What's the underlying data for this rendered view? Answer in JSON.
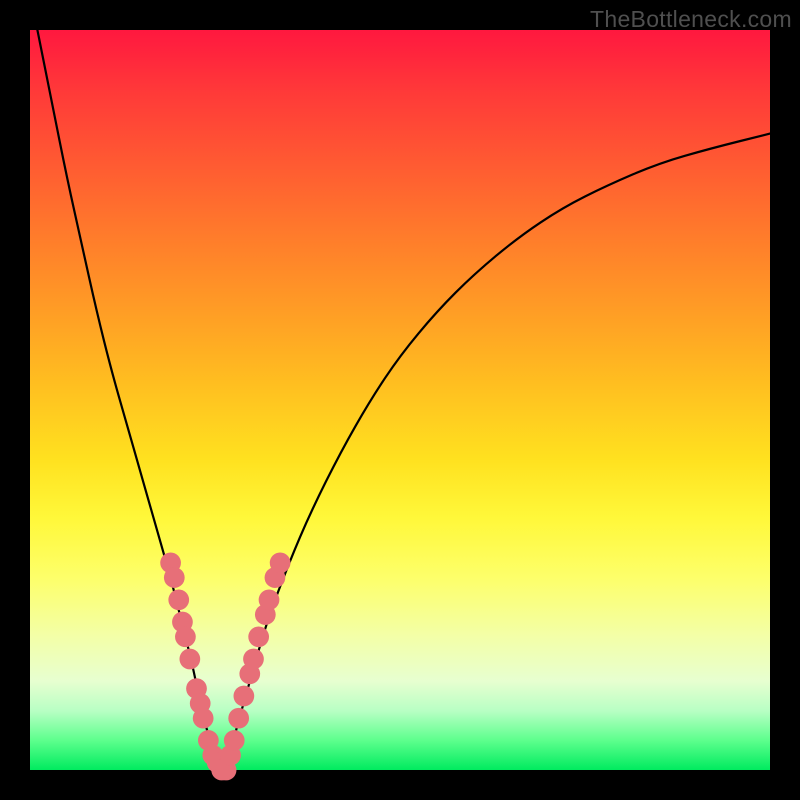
{
  "watermark": "TheBottleneck.com",
  "chart_data": {
    "type": "line",
    "title": "",
    "xlabel": "",
    "ylabel": "",
    "xlim": [
      0,
      100
    ],
    "ylim": [
      0,
      100
    ],
    "grid": false,
    "legend": false,
    "annotations": [],
    "gradient_stops": [
      {
        "pos": 0,
        "color": "#ff183f"
      },
      {
        "pos": 8,
        "color": "#ff3839"
      },
      {
        "pos": 18,
        "color": "#ff5a32"
      },
      {
        "pos": 28,
        "color": "#ff7c2b"
      },
      {
        "pos": 38,
        "color": "#ff9d25"
      },
      {
        "pos": 48,
        "color": "#ffbf20"
      },
      {
        "pos": 58,
        "color": "#ffe11f"
      },
      {
        "pos": 66,
        "color": "#fff83a"
      },
      {
        "pos": 74,
        "color": "#fdff6a"
      },
      {
        "pos": 82,
        "color": "#f3ffa8"
      },
      {
        "pos": 88,
        "color": "#e7ffd0"
      },
      {
        "pos": 92,
        "color": "#b8ffc4"
      },
      {
        "pos": 96,
        "color": "#5dff8d"
      },
      {
        "pos": 100,
        "color": "#00eb5f"
      }
    ],
    "series": [
      {
        "name": "bottleneck-curve",
        "color": "#000000",
        "x": [
          1,
          3,
          5,
          7,
          9,
          11,
          13,
          15,
          17,
          19,
          20,
          21,
          22,
          23,
          24,
          25,
          26,
          27,
          28,
          30,
          32,
          35,
          38,
          42,
          46,
          50,
          55,
          60,
          66,
          72,
          78,
          85,
          92,
          100
        ],
        "y": [
          100,
          90,
          80,
          71,
          62,
          54,
          47,
          40,
          33,
          26,
          22,
          18,
          14,
          9,
          5,
          2,
          0,
          2,
          6,
          13,
          20,
          28,
          35,
          43,
          50,
          56,
          62,
          67,
          72,
          76,
          79,
          82,
          84,
          86
        ]
      }
    ],
    "markers": {
      "name": "data-points",
      "color": "#e76f78",
      "radius": 1.4,
      "points": [
        {
          "x": 19.0,
          "y": 28
        },
        {
          "x": 19.5,
          "y": 26
        },
        {
          "x": 20.1,
          "y": 23
        },
        {
          "x": 20.6,
          "y": 20
        },
        {
          "x": 21.0,
          "y": 18
        },
        {
          "x": 21.6,
          "y": 15
        },
        {
          "x": 22.5,
          "y": 11
        },
        {
          "x": 23.0,
          "y": 9
        },
        {
          "x": 23.4,
          "y": 7
        },
        {
          "x": 24.1,
          "y": 4
        },
        {
          "x": 24.7,
          "y": 2
        },
        {
          "x": 25.3,
          "y": 1
        },
        {
          "x": 25.9,
          "y": 0
        },
        {
          "x": 26.5,
          "y": 0
        },
        {
          "x": 27.1,
          "y": 2
        },
        {
          "x": 27.6,
          "y": 4
        },
        {
          "x": 28.2,
          "y": 7
        },
        {
          "x": 28.9,
          "y": 10
        },
        {
          "x": 29.7,
          "y": 13
        },
        {
          "x": 30.2,
          "y": 15
        },
        {
          "x": 30.9,
          "y": 18
        },
        {
          "x": 31.8,
          "y": 21
        },
        {
          "x": 32.3,
          "y": 23
        },
        {
          "x": 33.1,
          "y": 26
        },
        {
          "x": 33.8,
          "y": 28
        }
      ]
    }
  }
}
